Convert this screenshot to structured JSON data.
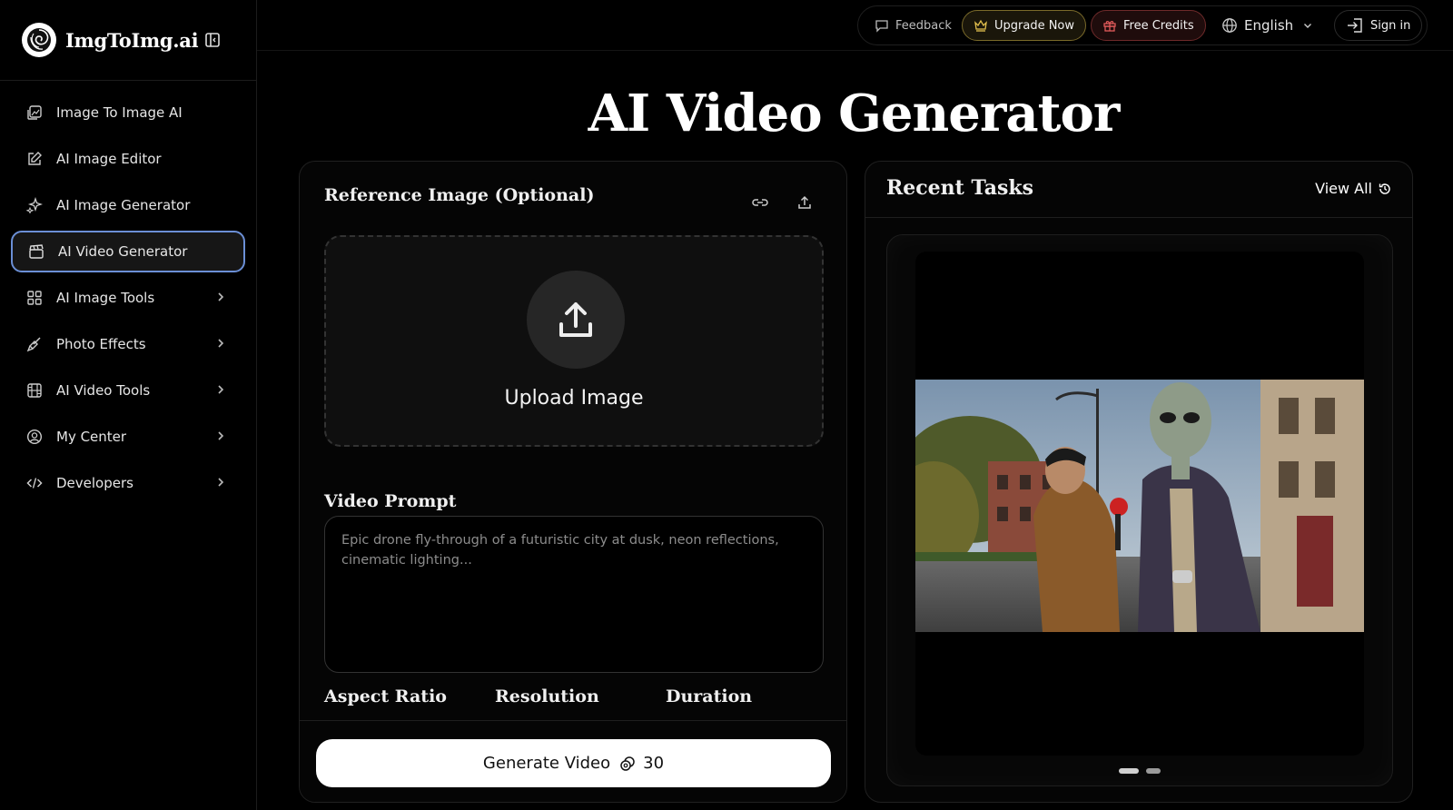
{
  "brand": {
    "name": "ImgToImg.ai"
  },
  "sidebar": {
    "items": [
      {
        "label": "Image To Image AI",
        "icon": "image-edit-icon",
        "has_chevron": false,
        "active": false
      },
      {
        "label": "AI Image Editor",
        "icon": "pencil-square-icon",
        "has_chevron": false,
        "active": false
      },
      {
        "label": "AI Image Generator",
        "icon": "sparkles-icon",
        "has_chevron": false,
        "active": false
      },
      {
        "label": "AI Video Generator",
        "icon": "clapperboard-icon",
        "has_chevron": false,
        "active": true
      },
      {
        "label": "AI Image Tools",
        "icon": "grid-icon",
        "has_chevron": true,
        "active": false
      },
      {
        "label": "Photo Effects",
        "icon": "brush-icon",
        "has_chevron": true,
        "active": false
      },
      {
        "label": "AI Video Tools",
        "icon": "film-icon",
        "has_chevron": true,
        "active": false
      },
      {
        "label": "My Center",
        "icon": "user-circle-icon",
        "has_chevron": true,
        "active": false
      },
      {
        "label": "Developers",
        "icon": "code-icon",
        "has_chevron": true,
        "active": false
      }
    ]
  },
  "topbar": {
    "feedback": "Feedback",
    "upgrade": "Upgrade Now",
    "credits": "Free Credits",
    "language": "English",
    "signin": "Sign in"
  },
  "page": {
    "title": "AI Video Generator"
  },
  "form": {
    "reference_title": "Reference Image (Optional)",
    "upload_label": "Upload Image",
    "prompt_label": "Video Prompt",
    "prompt_placeholder": "Epic drone fly-through of a futuristic city at dusk, neon reflections, cinematic lighting...",
    "aspect_ratio_label": "Aspect Ratio",
    "resolution_label": "Resolution",
    "duration_label": "Duration",
    "generate_label": "Generate Video",
    "generate_cost": "30"
  },
  "recent": {
    "title": "Recent Tasks",
    "view_all": "View All"
  },
  "colors": {
    "accent_active_border": "#6b8fd6",
    "upgrade_border": "#7a6a2a",
    "credits_border": "#6e2a2a"
  }
}
